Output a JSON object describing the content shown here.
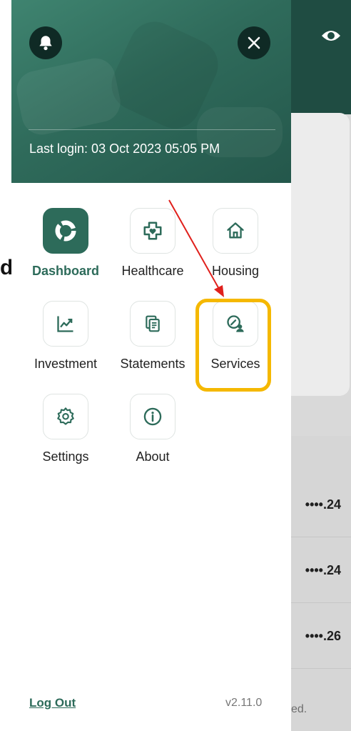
{
  "header": {
    "last_login": "Last login: 03 Oct 2023 05:05 PM"
  },
  "menu": {
    "items": [
      {
        "label": "Dashboard",
        "icon": "dashboard-icon",
        "active": true
      },
      {
        "label": "Healthcare",
        "icon": "healthcare-icon",
        "active": false
      },
      {
        "label": "Housing",
        "icon": "home-icon",
        "active": false
      },
      {
        "label": "Investment",
        "icon": "chart-icon",
        "active": false
      },
      {
        "label": "Statements",
        "icon": "documents-icon",
        "active": false
      },
      {
        "label": "Services",
        "icon": "services-icon",
        "active": false
      },
      {
        "label": "Settings",
        "icon": "gear-icon",
        "active": false
      },
      {
        "label": "About",
        "icon": "info-icon",
        "active": false
      }
    ]
  },
  "footer": {
    "logout_label": "Log Out",
    "version": "v2.11.0"
  },
  "background": {
    "rows": [
      "••••.24",
      "••••.24",
      "••••.26"
    ],
    "footer_text": "ed."
  },
  "annotation": {
    "letter": "d"
  },
  "colors": {
    "brand": "#2d6b5a",
    "highlight": "#f5b800",
    "arrow": "#e0201c"
  }
}
